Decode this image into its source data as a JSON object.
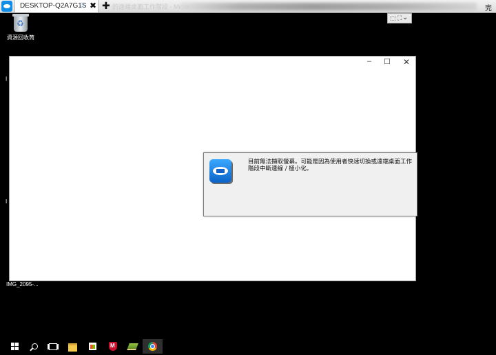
{
  "tabs": {
    "active_title": "DESKTOP-Q2A7G1S",
    "star": "☆",
    "close": "✖",
    "add": "✚",
    "ghost_title": "的遠端桌面工作階段 - Micro"
  },
  "right_edge_text": "完",
  "session_toolbar": {
    "icon1": "⬚ ⛶",
    "icon2": "⌄"
  },
  "desktop": {
    "recycle_bin_label": "資源回收筒",
    "side_letters": [
      "I",
      "I"
    ],
    "image_label": "IMG_2095-..."
  },
  "window": {
    "min": "–",
    "max": "☐",
    "close": "✕"
  },
  "dialog": {
    "message": "目前無法擷取螢幕。可能是因為使用者快速切換或遠端桌面工作階段中斷連線 / 極小化。"
  },
  "taskbar": {
    "items": [
      "start",
      "search",
      "task-view",
      "file-explorer",
      "store",
      "mcafee",
      "book",
      "chrome"
    ]
  }
}
